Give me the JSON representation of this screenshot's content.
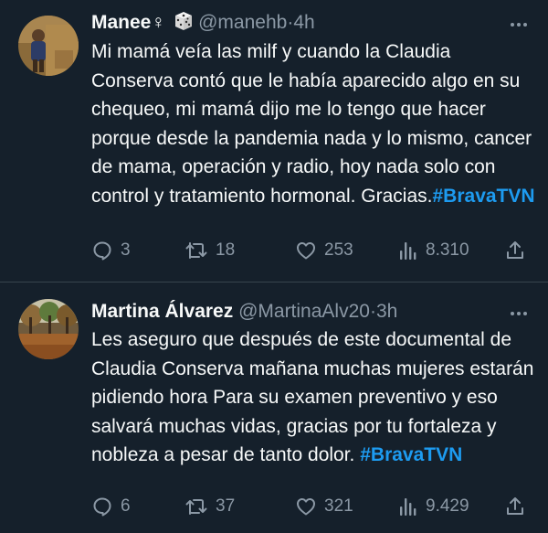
{
  "colors": {
    "background": "#15202b",
    "text": "#f7f9f9",
    "muted": "#8b98a5",
    "hashtag": "#1d9bf0",
    "divider": "#38444d"
  },
  "tweets": [
    {
      "display_name": "Manee♀",
      "badge_icon": "game-die-icon",
      "handle": "@manehb",
      "separator": "·",
      "time": "4h",
      "text": "Mi mamá veía las milf y cuando la Claudia Conserva contó que le había aparecido algo en su chequeo, mi mamá dijo me lo tengo que hacer porque desde la pandemia nada y lo mismo, cancer de mama, operación y radio, hoy nada solo con control y tratamiento hormonal. Gracias.",
      "hashtag": "#BravaTVN",
      "replies": "3",
      "retweets": "18",
      "likes": "253",
      "views": "8.310"
    },
    {
      "display_name": "Martina Álvarez",
      "handle": "@MartinaAlv20",
      "separator": "·",
      "time": "3h",
      "text": "Les aseguro que después de este documental de Claudia Conserva mañana muchas mujeres estarán pidiendo hora Para su examen preventivo y eso salvará muchas vidas, gracias por tu fortaleza y nobleza a pesar de tanto dolor.",
      "hashtag": "#BravaTVN",
      "replies": "6",
      "retweets": "37",
      "likes": "321",
      "views": "9.429"
    }
  ]
}
